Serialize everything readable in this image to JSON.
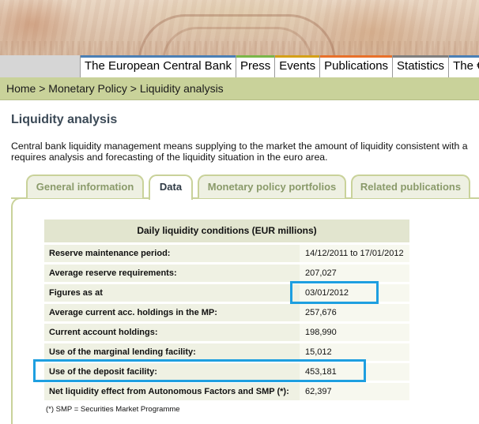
{
  "top_nav": {
    "items": [
      {
        "label": "The European Central Bank",
        "color": "#4a7fb5"
      },
      {
        "label": "Press",
        "color": "#7ab648"
      },
      {
        "label": "Events",
        "color": "#d4a017"
      },
      {
        "label": "Publications",
        "color": "#e8702a"
      },
      {
        "label": "Statistics",
        "color": "#7f7f7f"
      },
      {
        "label": "The €u",
        "color": "#4a7fb5"
      }
    ]
  },
  "breadcrumb": "Home > Monetary Policy > Liquidity analysis",
  "page_title": "Liquidity analysis",
  "intro": {
    "line1": "Central bank liquidity management means supplying to the market the amount of liquidity consistent with a",
    "line2": "requires analysis and forecasting of the liquidity situation in the euro area."
  },
  "tabs": [
    {
      "label": "General information",
      "active": false
    },
    {
      "label": "Data",
      "active": true
    },
    {
      "label": "Monetary policy portfolios",
      "active": false
    },
    {
      "label": "Related publications",
      "active": false
    }
  ],
  "table": {
    "title": "Daily liquidity conditions (EUR millions)",
    "rows": [
      {
        "label": "Reserve maintenance period:",
        "value": "14/12/2011 to 17/01/2012"
      },
      {
        "label": "Average reserve requirements:",
        "value": "207,027"
      },
      {
        "label": "Figures as at",
        "value": "03/01/2012"
      },
      {
        "label": "Average current acc. holdings in the MP:",
        "value": "257,676"
      },
      {
        "label": "Current account holdings:",
        "value": "198,990"
      },
      {
        "label": "Use of the marginal lending facility:",
        "value": "15,012"
      },
      {
        "label": "Use of the deposit facility:",
        "value": "453,181"
      },
      {
        "label": "Net liquidity effect from Autonomous Factors and SMP (*):",
        "value": "62,397"
      }
    ]
  },
  "footnote": "(*) SMP = Securities Market Programme",
  "colors": {
    "highlight": "#1e9fe0",
    "breadcrumb_bg": "#c9d29a",
    "tab_border": "#c9d29a"
  }
}
